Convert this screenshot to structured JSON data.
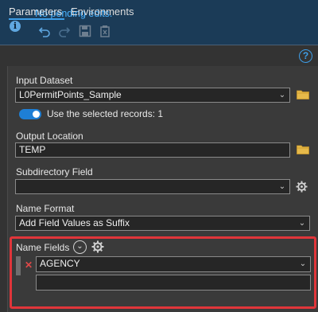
{
  "edit_bar": {
    "status": "No pending edits.",
    "icons": [
      "info-icon",
      "undo-icon",
      "redo-icon",
      "save-edits-icon",
      "discard-edits-icon"
    ]
  },
  "tabs": [
    {
      "label": "Parameters",
      "active": true
    },
    {
      "label": "Environments",
      "active": false
    }
  ],
  "params": {
    "input_dataset": {
      "label": "Input Dataset",
      "value": "L0PermitPoints_Sample"
    },
    "use_selected": {
      "label": "Use the selected records: 1",
      "on": true
    },
    "output_location": {
      "label": "Output Location",
      "value": "TEMP"
    },
    "subdirectory_field": {
      "label": "Subdirectory Field",
      "value": ""
    },
    "name_format": {
      "label": "Name Format",
      "value": "Add Field Values as Suffix"
    },
    "name_fields": {
      "label": "Name Fields",
      "rows": [
        "AGENCY",
        ""
      ]
    }
  },
  "colors": {
    "accent": "#3e9ee8",
    "status_text": "#4ab3ff",
    "highlight": "#e0353a",
    "toggle_on": "#1e7fd6"
  }
}
